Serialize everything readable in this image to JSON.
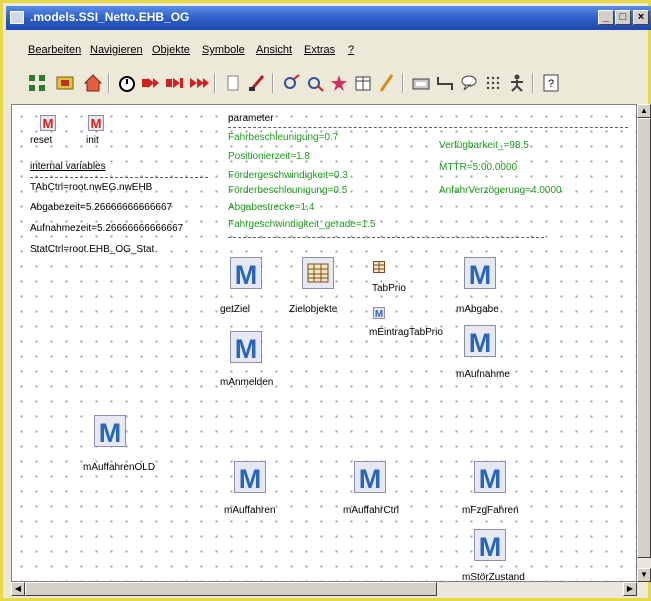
{
  "window": {
    "title": ".models.SSI_Netto.EHB_OG"
  },
  "menu": [
    "Bearbeiten",
    "Navigieren",
    "Objekte",
    "Symbole",
    "Ansicht",
    "Extras",
    "?"
  ],
  "toolbar": {
    "icons": [
      "structure-icon",
      "open-icon",
      "home-icon",
      "timer-icon",
      "run-icon",
      "step-icon",
      "fast-forward-icon",
      "copy-icon",
      "edit-icon",
      "link-icon",
      "unlink-icon",
      "star-icon",
      "table-icon",
      "pencil-icon",
      "view-icon",
      "connector-icon",
      "balloon-icon",
      "grid-icon",
      "figure-icon",
      "help-icon"
    ]
  },
  "canvas": {
    "reset_label": "reset",
    "init_label": "init",
    "internal_header": "internal variables",
    "internal_vars": [
      "TAbCtrl=root.nwEG.nwEHB",
      "Abgabezeit=5.26666666666667",
      "Aufnahmezeit=5.26666666666667",
      "StatCtrl=root.EHB_OG_Stat"
    ],
    "parameter_header": "parameter",
    "params_left": [
      "Fahrbeschleunigung=0.7",
      "Positionierzeit=1.8",
      "Fördergeschwindigkeit=0.3",
      "Förderbeschleunigung=0.5",
      "Abgabestrecke=1.4",
      "Fahrgeschwindigkeit_gerade=1.5"
    ],
    "params_right": [
      "Verfügbarkeit_=98.5",
      "MTTR=5:00.0000",
      "AnfahrVerzögerung=4.0000"
    ],
    "methods": {
      "getZiel": "getZiel",
      "zielobjekte": "Zielobjekte",
      "tabprio": "TabPrio",
      "mEintragTabPrio": "mEintragTabPrio",
      "mAbgabe": "mAbgabe",
      "mAnmelden": "mAnmelden",
      "mAufnahme": "mAufnahme",
      "mAuffahrenOLD": "mAuffahrenOLD",
      "mAuffahren": "mAuffahren",
      "mAuffahrCtrl": "mAuffahrCtrl",
      "mFzgFahren": "mFzgFahren",
      "mStoerZustand": "mStörZustand"
    }
  }
}
